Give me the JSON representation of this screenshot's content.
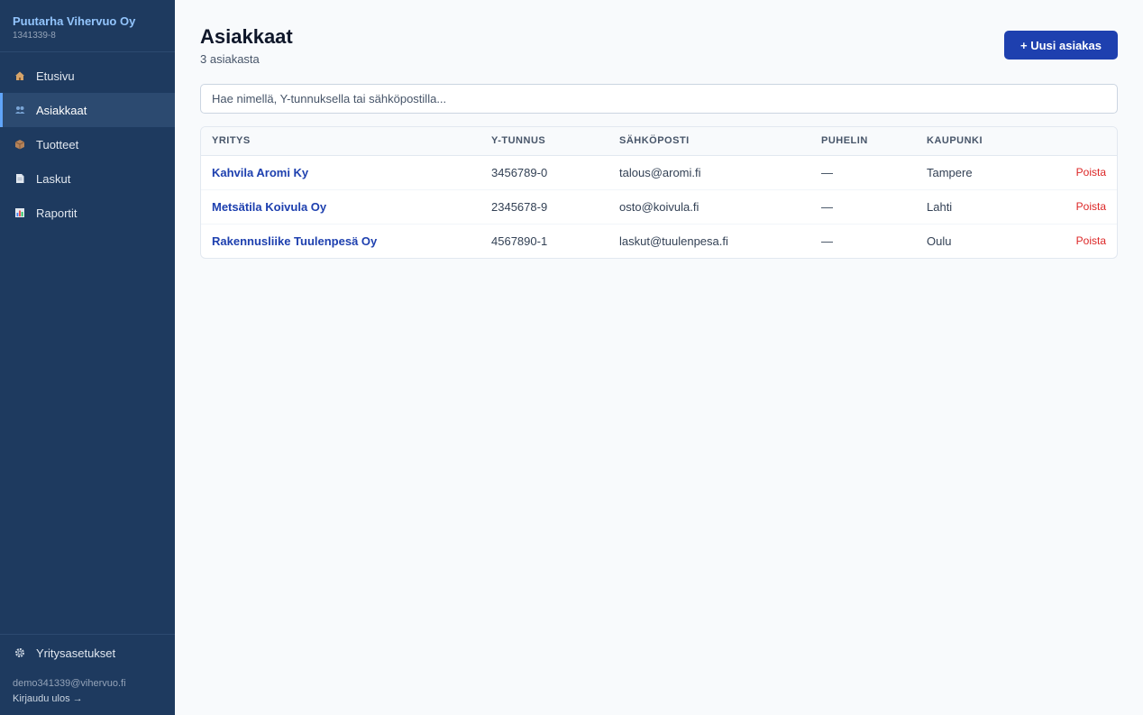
{
  "company": {
    "name": "Puutarha Vihervuo Oy",
    "id": "1341339-8"
  },
  "nav": [
    {
      "label": "Etusivu",
      "icon": "home-icon",
      "active": false
    },
    {
      "label": "Asiakkaat",
      "icon": "users-icon",
      "active": true
    },
    {
      "label": "Tuotteet",
      "icon": "package-icon",
      "active": false
    },
    {
      "label": "Laskut",
      "icon": "document-icon",
      "active": false
    },
    {
      "label": "Raportit",
      "icon": "chart-icon",
      "active": false
    }
  ],
  "settings": {
    "label": "Yritysasetukset",
    "icon": "gear-icon"
  },
  "user": {
    "email": "demo341339@vihervuo.fi",
    "logout": "Kirjaudu ulos →"
  },
  "page": {
    "title": "Asiakkaat",
    "subtitle": "3 asiakasta",
    "new_button": "+ Uusi asiakas"
  },
  "search": {
    "placeholder": "Hae nimellä, Y-tunnuksella tai sähköpostilla...",
    "value": ""
  },
  "table": {
    "headers": [
      "YRITYS",
      "Y-TUNNUS",
      "SÄHKÖPOSTI",
      "PUHELIN",
      "KAUPUNKI",
      ""
    ],
    "rows": [
      {
        "company": "Kahvila Aromi Ky",
        "ytunnus": "3456789-0",
        "email": "talous@aromi.fi",
        "phone": "—",
        "city": "Tampere",
        "action": "Poista"
      },
      {
        "company": "Metsätila Koivula Oy",
        "ytunnus": "2345678-9",
        "email": "osto@koivula.fi",
        "phone": "—",
        "city": "Lahti",
        "action": "Poista"
      },
      {
        "company": "Rakennusliike Tuulenpesä Oy",
        "ytunnus": "4567890-1",
        "email": "laskut@tuulenpesa.fi",
        "phone": "—",
        "city": "Oulu",
        "action": "Poista"
      }
    ]
  },
  "colors": {
    "sidebar": "#1e3a5f",
    "accent": "#1e40af",
    "danger": "#dc2626",
    "brand": "#93c5fd"
  }
}
